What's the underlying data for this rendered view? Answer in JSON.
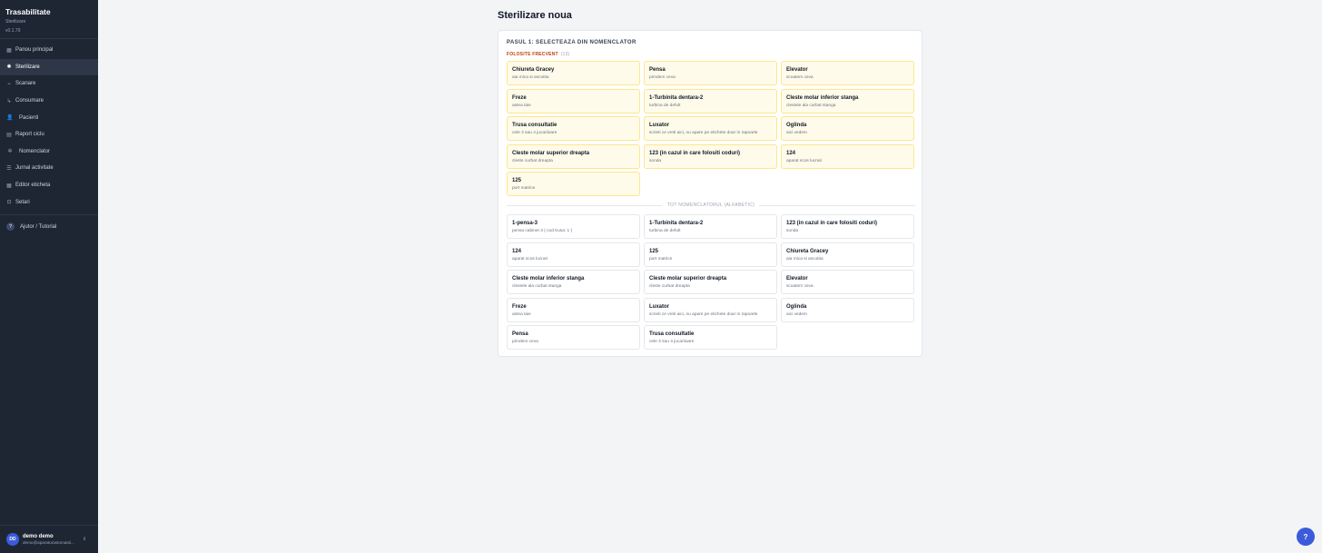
{
  "sidebar": {
    "title": "Trasabilitate",
    "subtitle": "Sterilizare",
    "version": "v0.1.79",
    "items": [
      {
        "label": "Panou principal",
        "icon": "grid-icon",
        "glyph": "▦"
      },
      {
        "label": "Sterilizare",
        "icon": "sterilize-icon",
        "glyph": "✺"
      },
      {
        "label": "Scanare",
        "icon": "scan-icon",
        "glyph": "⌁"
      },
      {
        "label": "Consumare",
        "icon": "consume-icon",
        "glyph": "↳"
      },
      {
        "label": "Pacienti",
        "icon": "patients-icon",
        "glyph": "👤"
      },
      {
        "label": "Raport ciclu",
        "icon": "report-icon",
        "glyph": "▤"
      },
      {
        "label": "Nomenclator",
        "icon": "settings-gear-icon",
        "glyph": "✲"
      },
      {
        "label": "Jurnal activitate",
        "icon": "list-icon",
        "glyph": "☰"
      },
      {
        "label": "Editor eticheta",
        "icon": "label-icon",
        "glyph": "▦"
      },
      {
        "label": "Setari",
        "icon": "lock-icon",
        "glyph": "⊡"
      }
    ],
    "help": {
      "label": "Ajutor / Tutorial",
      "glyph": "?"
    },
    "user": {
      "initials": "DD",
      "name": "demo demo",
      "email": "demo@aparaturastomatol..."
    }
  },
  "page": {
    "title": "Sterilizare noua",
    "step_title": "PASUL 1: SELECTEAZA DIN NOMENCLATOR",
    "freq_label": "FOLOSITE FRECVENT",
    "freq_count": "(13)",
    "all_label": "TOT NOMENCLATORUL (ALFABETIC)"
  },
  "frequent": [
    {
      "name": "Chiureta Gracey",
      "desc": "aia mica si ascutita"
    },
    {
      "name": "Pensa",
      "desc": "prindem ceva"
    },
    {
      "name": "Elevator",
      "desc": "scoatem ceva"
    },
    {
      "name": "Freze",
      "desc": "astea taie"
    },
    {
      "name": "1-Turbinita dentara-2",
      "desc": "turbina de defult"
    },
    {
      "name": "Cleste molar inferior stanga",
      "desc": "clestele ala curbat stanga"
    },
    {
      "name": "Trusa consultatie",
      "desc": "cele 3 sau 4 jucariioare"
    },
    {
      "name": "Luxator",
      "desc": "scrieti ce vreti aici, nu apare pe etichete doar in rapoarte"
    },
    {
      "name": "Oglinda",
      "desc": "aici vedem"
    },
    {
      "name": "Cleste molar superior dreapta",
      "desc": "cleste curbat dreapta"
    },
    {
      "name": "123 (in cazul in care folositi coduri)",
      "desc": "sonda"
    },
    {
      "name": "124",
      "desc": "aparat scos lucrari"
    },
    {
      "name": "125",
      "desc": "port matrice"
    }
  ],
  "all": [
    {
      "name": "1-pensa-3",
      "desc": "pensa cabinet 3 ( cod trusa: 1 )"
    },
    {
      "name": "1-Turbinita dentara-2",
      "desc": "turbina de defult"
    },
    {
      "name": "123 (in cazul in care folositi coduri)",
      "desc": "sonda"
    },
    {
      "name": "124",
      "desc": "aparat scos lucrari"
    },
    {
      "name": "125",
      "desc": "port matrice"
    },
    {
      "name": "Chiureta Gracey",
      "desc": "aia mica si ascutita"
    },
    {
      "name": "Cleste molar inferior stanga",
      "desc": "clestele ala curbat stanga"
    },
    {
      "name": "Cleste molar superior dreapta",
      "desc": "cleste curbat dreapta"
    },
    {
      "name": "Elevator",
      "desc": "scoatem ceva"
    },
    {
      "name": "Freze",
      "desc": "astea taie"
    },
    {
      "name": "Luxator",
      "desc": "scrieti ce vreti aici, nu apare pe etichete doar in rapoarte"
    },
    {
      "name": "Oglinda",
      "desc": "aici vedem"
    },
    {
      "name": "Pensa",
      "desc": "prindem ceva"
    },
    {
      "name": "Trusa consultatie",
      "desc": "cele 3 sau 4 jucariioare"
    }
  ],
  "fab": {
    "glyph": "?"
  },
  "colors": {
    "sidebar": "#1e2533",
    "accent": "#3b5bdb",
    "frequent_label": "#c2410c",
    "frequent_card": "#fffbeb"
  }
}
